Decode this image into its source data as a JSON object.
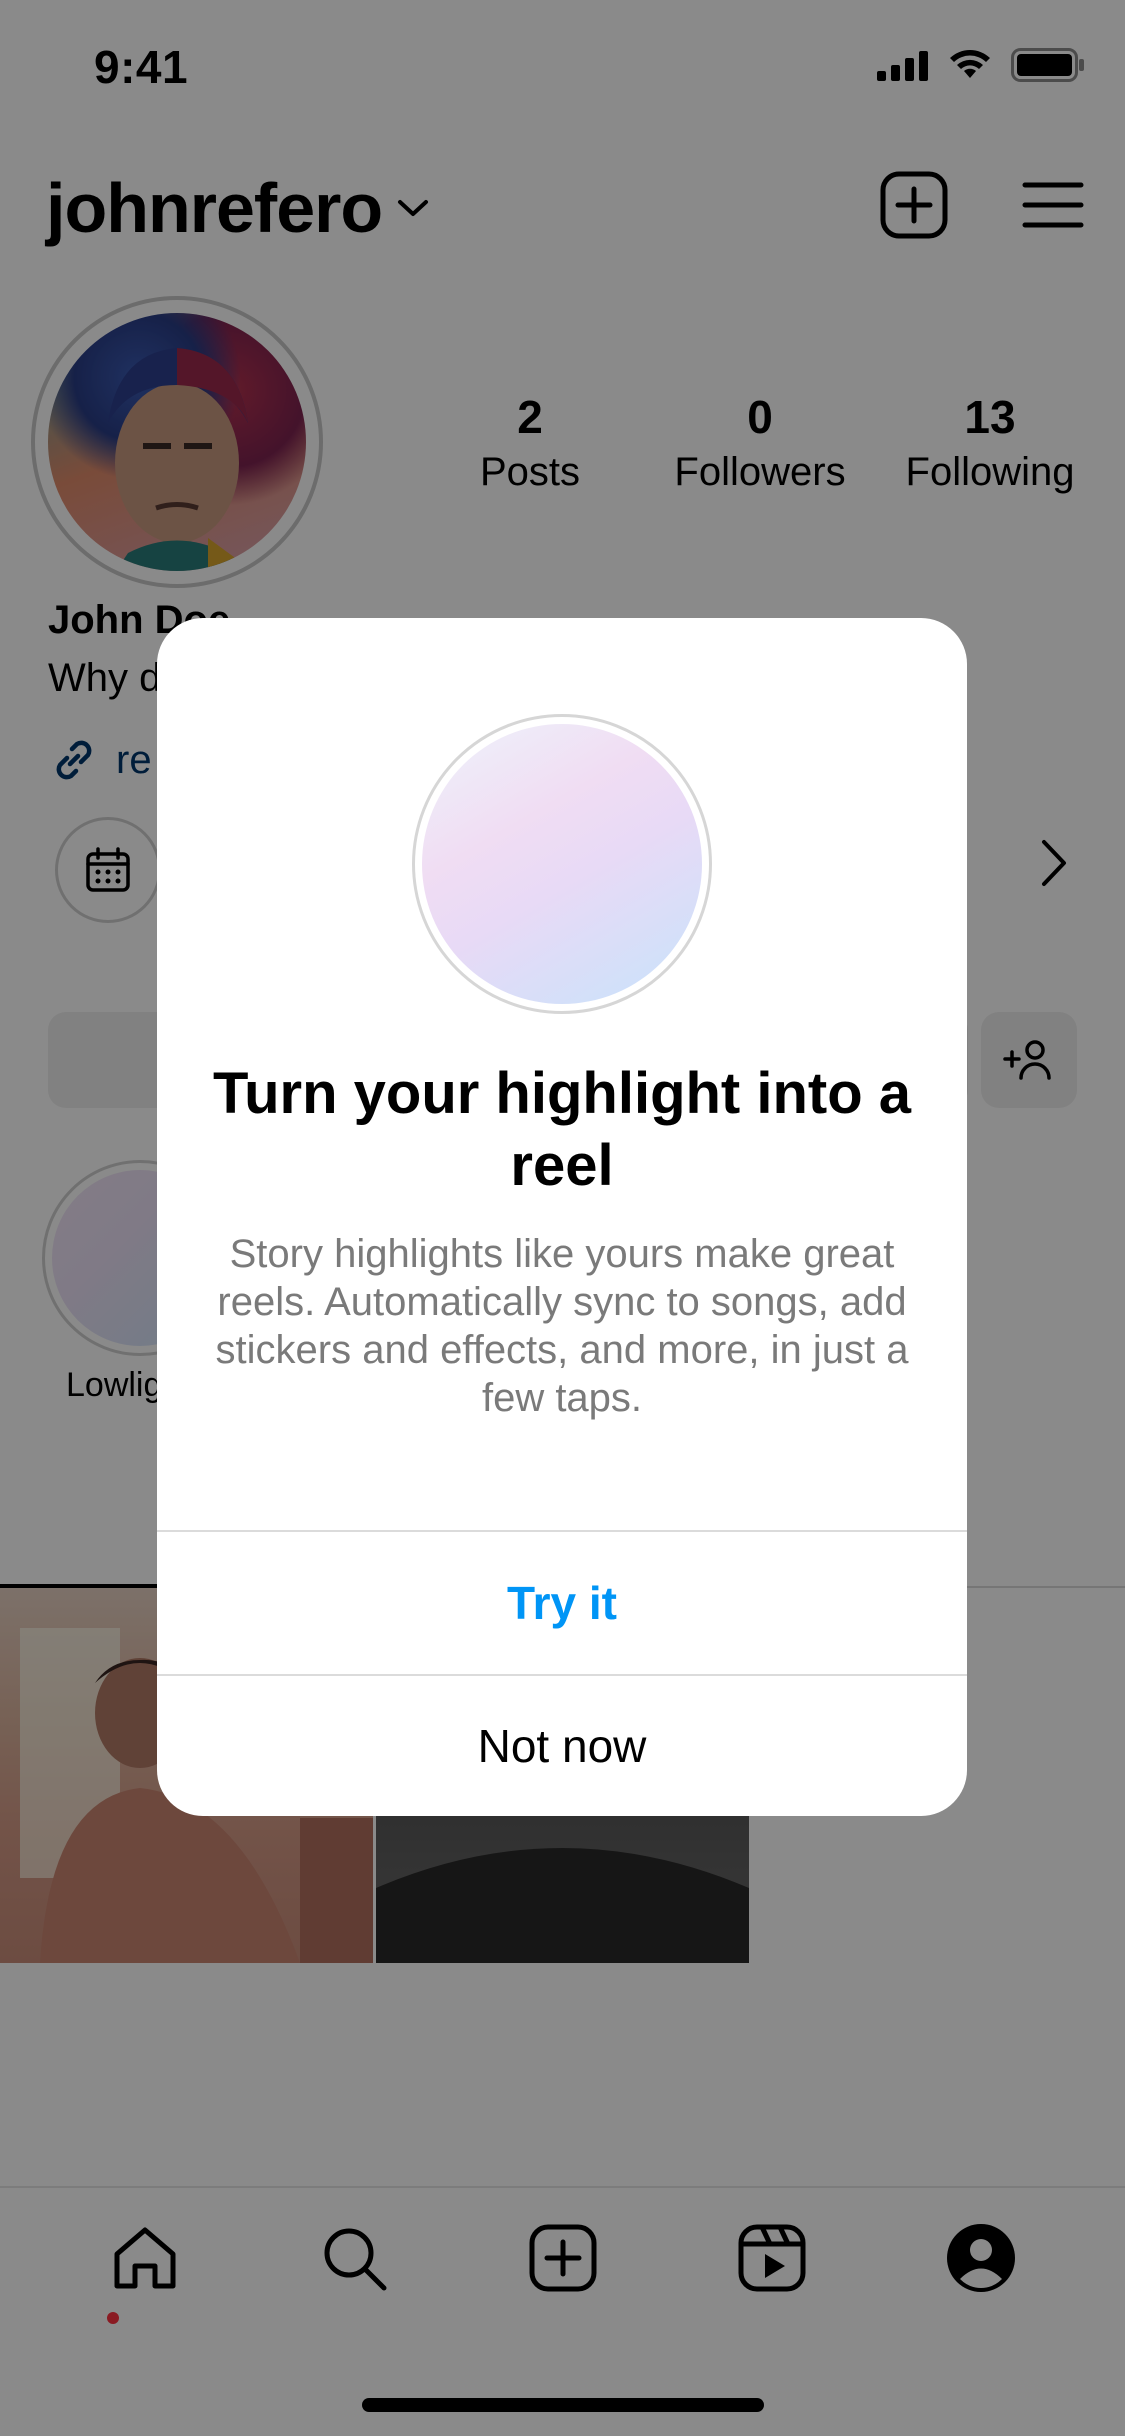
{
  "status_bar": {
    "time": "9:41"
  },
  "header": {
    "username": "johnrefero"
  },
  "profile": {
    "stats": [
      {
        "value": "2",
        "label": "Posts"
      },
      {
        "value": "0",
        "label": "Followers"
      },
      {
        "value": "13",
        "label": "Following"
      }
    ],
    "display_name": "John Doe",
    "bio": "Why d",
    "link_text": "re"
  },
  "highlights": [
    {
      "label": "Lowlig"
    }
  ],
  "modal": {
    "title": "Turn your highlight into a reel",
    "body": "Story highlights like yours make great reels. Automatically sync to songs, add stickers and effects, and more, in just a few taps.",
    "primary_action": "Try it",
    "secondary_action": "Not now"
  },
  "bottom_nav": {
    "items": [
      {
        "name": "home",
        "icon": "home-icon",
        "active": true
      },
      {
        "name": "search",
        "icon": "search-icon"
      },
      {
        "name": "create",
        "icon": "add-square-icon"
      },
      {
        "name": "reels",
        "icon": "reels-icon"
      },
      {
        "name": "profile",
        "icon": "profile-icon"
      }
    ]
  },
  "colors": {
    "accent": "#0095f6",
    "link": "#00376b",
    "notification_dot": "#ff3040"
  }
}
